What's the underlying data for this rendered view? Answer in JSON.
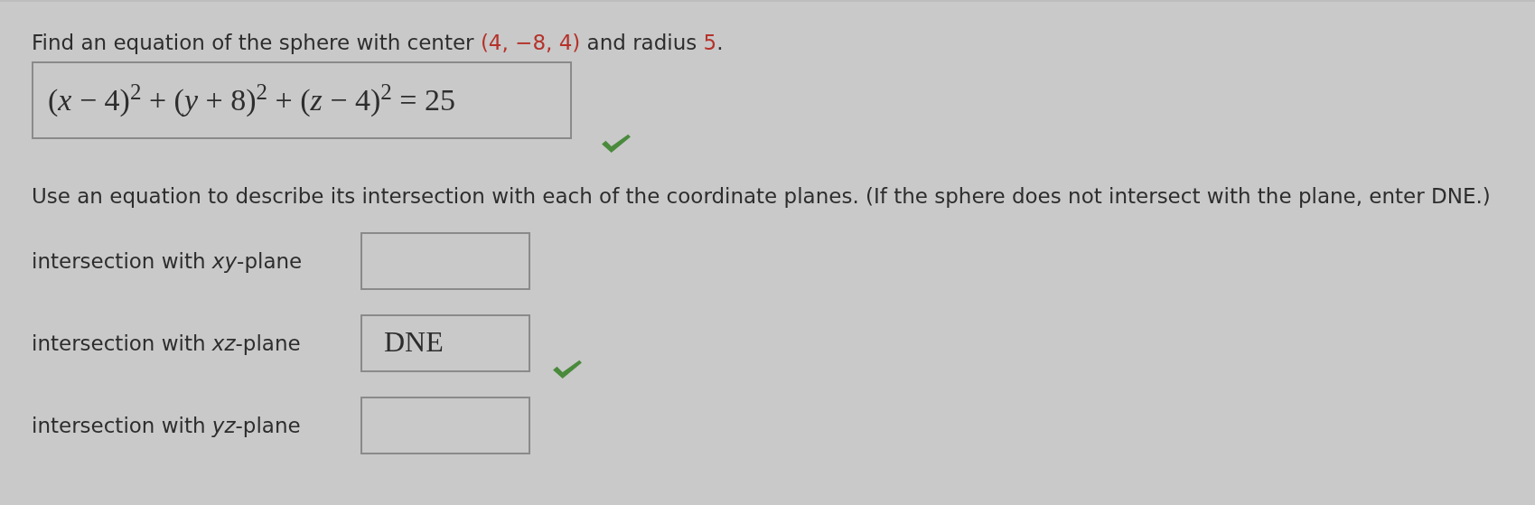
{
  "question": {
    "parts": [
      {
        "kind": "text",
        "text": "Find an equation of the sphere with center "
      },
      {
        "kind": "value",
        "text": "(4, −8, 4)"
      },
      {
        "kind": "text",
        "text": " and radius "
      },
      {
        "kind": "value",
        "text": "5"
      },
      {
        "kind": "text",
        "text": "."
      }
    ]
  },
  "answer": {
    "value": "(*x* − 4)$^{2}$ + (*y* + 8)$^{2}$ + (*z* − 4)$^{2}$ = 25",
    "correct": true
  },
  "instruction": "Use an equation to describe its intersection with each of the coordinate planes. (If the sphere does not intersect with the plane, enter DNE.)",
  "rows": [
    {
      "label": "intersection with *xy*-plane",
      "correct": false
    },
    {
      "label": "intersection with *xz*-plane",
      "value": "DNE",
      "correct": true
    },
    {
      "label": "intersection with *yz*-plane",
      "correct": false
    }
  ]
}
